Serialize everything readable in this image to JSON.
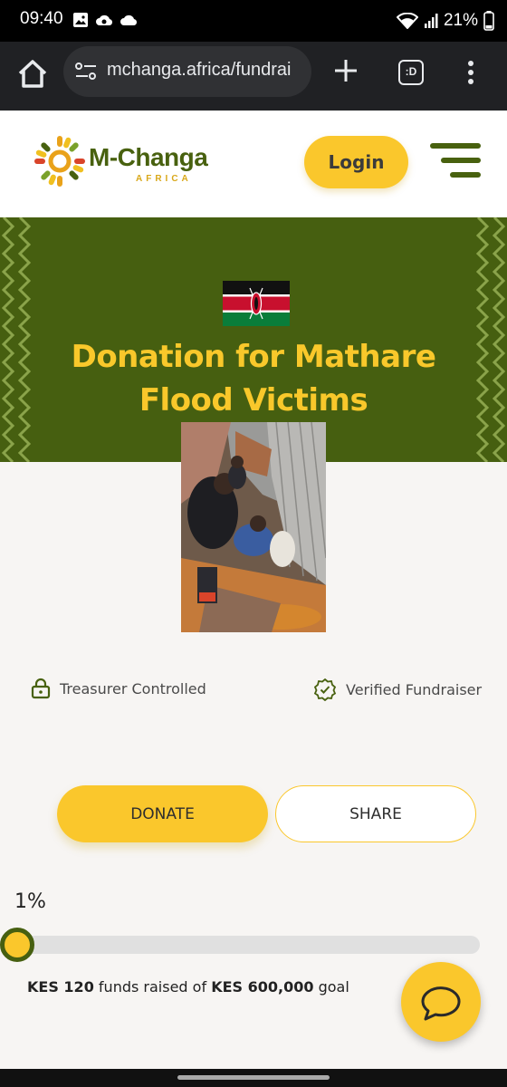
{
  "status_bar": {
    "time": "09:40",
    "battery_text": "21%",
    "icons_left": [
      "image-icon",
      "cloud-sync-icon",
      "cloud-icon"
    ],
    "icons_right": [
      "wifi-icon",
      "signal-icon",
      "battery-icon"
    ]
  },
  "browser": {
    "url": "mchanga.africa/fundrai",
    "tab_count": ":D"
  },
  "header": {
    "logo_name": "M-Changa",
    "logo_sub": "AFRICA",
    "login_label": "Login"
  },
  "hero": {
    "title": "Donation for Mathare Flood Victims"
  },
  "features": {
    "treasurer": "Treasurer Controlled",
    "verified": "Verified Fundraiser"
  },
  "actions": {
    "donate": "DONATE",
    "share": "SHARE"
  },
  "progress": {
    "percent_label": "1%",
    "fraction": 0.0002,
    "raised_amount": "KES 120",
    "raised_text": "funds raised of",
    "goal_amount": "KES 600,000",
    "goal_text": "goal"
  },
  "colors": {
    "brand_green": "#465f10",
    "brand_yellow": "#fac72c"
  }
}
